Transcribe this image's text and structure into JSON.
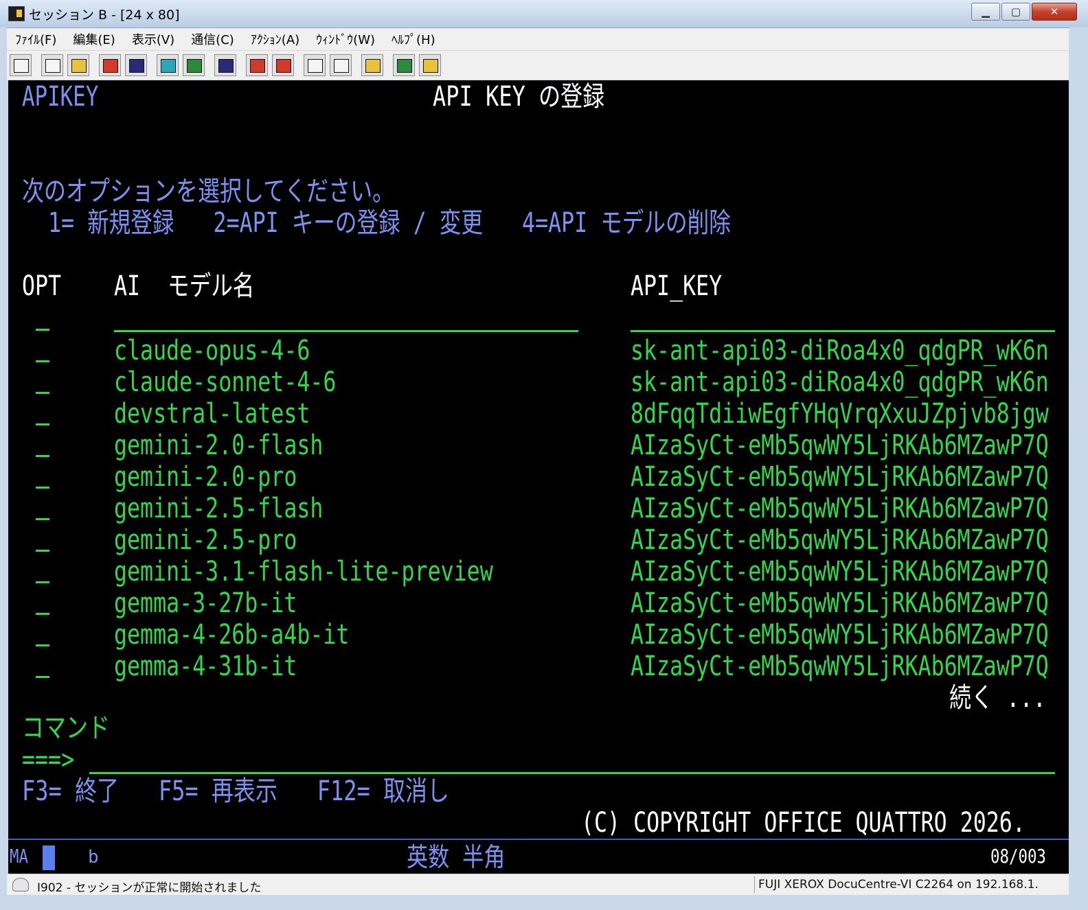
{
  "window": {
    "title": "セッション B - [24 x 80]",
    "minimize": "▁",
    "maximize": "▢",
    "close": "✕"
  },
  "menu": [
    "ﾌｧｲﾙ(F)",
    "編集(E)",
    "表示(V)",
    "通信(C)",
    "ｱｸｼｮﾝ(A)",
    "ｳｨﾝﾄﾞｳ(W)",
    "ﾍﾙﾌﾟ(H)"
  ],
  "toolbar_icons": [
    "print-screen-icon",
    "copy-icon",
    "paste-icon",
    "send-icon",
    "receive-icon",
    "display-icon",
    "session-icon",
    "macro-icon",
    "record-macro-icon",
    "stop-macro-icon",
    "play-macro-icon",
    "pause-macro-icon",
    "clipboard-icon",
    "web-icon",
    "help-icon"
  ],
  "terminal": {
    "program_id": "APIKEY",
    "screen_title": "API KEY の登録",
    "instruction": "次のオプションを選択してください。",
    "options_line": "1= 新規登録   2=API キーの登録 / 変更   4=API モデルの削除",
    "headers": {
      "opt": "OPT",
      "ai": "AI",
      "model": "モデル名",
      "api_key": "API_KEY"
    },
    "rows": [
      {
        "model": "claude-opus-4-6",
        "key": "sk-ant-api03-diRoa4x0_qdgPR_wK6n"
      },
      {
        "model": "claude-sonnet-4-6",
        "key": "sk-ant-api03-diRoa4x0_qdgPR_wK6n"
      },
      {
        "model": "devstral-latest",
        "key": "8dFqqTdiiwEgfYHqVrqXxuJZpjvb8jgw"
      },
      {
        "model": "gemini-2.0-flash",
        "key": "AIzaSyCt-eMb5qwWY5LjRKAb6MZawP7Q"
      },
      {
        "model": "gemini-2.0-pro",
        "key": "AIzaSyCt-eMb5qwWY5LjRKAb6MZawP7Q"
      },
      {
        "model": "gemini-2.5-flash",
        "key": "AIzaSyCt-eMb5qwWY5LjRKAb6MZawP7Q"
      },
      {
        "model": "gemini-2.5-pro",
        "key": "AIzaSyCt-eMb5qwWY5LjRKAb6MZawP7Q"
      },
      {
        "model": "gemini-3.1-flash-lite-preview",
        "key": "AIzaSyCt-eMb5qwWY5LjRKAb6MZawP7Q"
      },
      {
        "model": "gemma-3-27b-it",
        "key": "AIzaSyCt-eMb5qwWY5LjRKAb6MZawP7Q"
      },
      {
        "model": "gemma-4-26b-a4b-it",
        "key": "AIzaSyCt-eMb5qwWY5LjRKAb6MZawP7Q"
      },
      {
        "model": "gemma-4-31b-it",
        "key": "AIzaSyCt-eMb5qwWY5LjRKAb6MZawP7Q"
      }
    ],
    "more": "続く ...",
    "command_label": "コマンド",
    "command_prompt": "===>",
    "command_value": "",
    "function_keys": "F3= 終了   F5= 再表示   F12= 取消し",
    "copyright": "(C) COPYRIGHT OFFICE QUATTRO 2026."
  },
  "oia": {
    "mode": "MA",
    "indicator": "b",
    "input_mode": "英数 半角",
    "cursor_pos": "08/003"
  },
  "status": {
    "message": "I902 - セッションが正常に開始されました",
    "host": "FUJI XEROX DocuCentre-VI C2264 on 192.168.1."
  }
}
